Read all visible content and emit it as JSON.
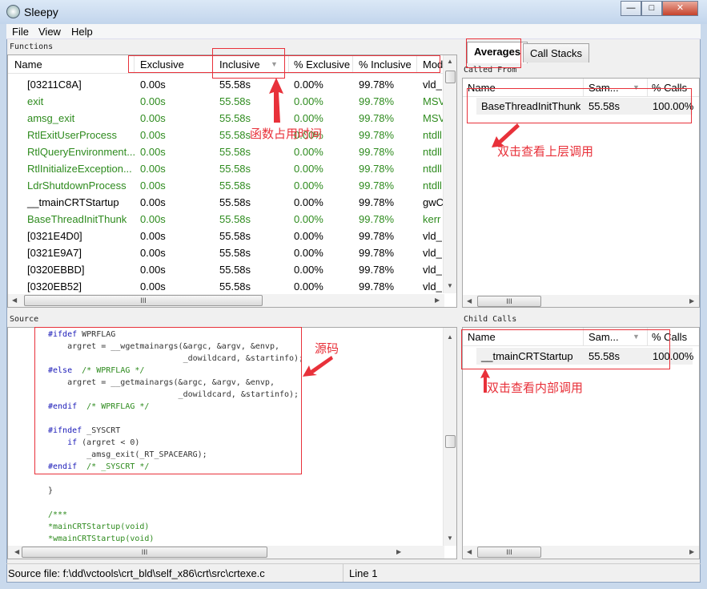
{
  "window": {
    "title": "Sleepy",
    "controls": [
      "minimize",
      "maximize",
      "close"
    ]
  },
  "menu": [
    "File",
    "View",
    "Help"
  ],
  "functions": {
    "label": "Functions",
    "columns": [
      "Name",
      "Exclusive",
      "Inclusive",
      "% Exclusive",
      "% Inclusive",
      "Mod"
    ],
    "sorted_by": "Inclusive",
    "rows": [
      {
        "name": "[03211C8A]",
        "exclusive": "0.00s",
        "inclusive": "55.58s",
        "pct_exclusive": "0.00%",
        "pct_inclusive": "99.78%",
        "module": "vld_:",
        "color": "black"
      },
      {
        "name": "exit",
        "exclusive": "0.00s",
        "inclusive": "55.58s",
        "pct_exclusive": "0.00%",
        "pct_inclusive": "99.78%",
        "module": "MSV",
        "color": "green"
      },
      {
        "name": "amsg_exit",
        "exclusive": "0.00s",
        "inclusive": "55.58s",
        "pct_exclusive": "0.00%",
        "pct_inclusive": "99.78%",
        "module": "MSV",
        "color": "green"
      },
      {
        "name": "RtlExitUserProcess",
        "exclusive": "0.00s",
        "inclusive": "55.58s",
        "pct_exclusive": "0.00%",
        "pct_inclusive": "99.78%",
        "module": "ntdll",
        "color": "green"
      },
      {
        "name": "RtlQueryEnvironment...",
        "exclusive": "0.00s",
        "inclusive": "55.58s",
        "pct_exclusive": "0.00%",
        "pct_inclusive": "99.78%",
        "module": "ntdll",
        "color": "green"
      },
      {
        "name": "RtlInitializeException...",
        "exclusive": "0.00s",
        "inclusive": "55.58s",
        "pct_exclusive": "0.00%",
        "pct_inclusive": "99.78%",
        "module": "ntdll",
        "color": "green"
      },
      {
        "name": "LdrShutdownProcess",
        "exclusive": "0.00s",
        "inclusive": "55.58s",
        "pct_exclusive": "0.00%",
        "pct_inclusive": "99.78%",
        "module": "ntdll",
        "color": "green"
      },
      {
        "name": "__tmainCRTStartup",
        "exclusive": "0.00s",
        "inclusive": "55.58s",
        "pct_exclusive": "0.00%",
        "pct_inclusive": "99.78%",
        "module": "gwC",
        "color": "black"
      },
      {
        "name": "BaseThreadInitThunk",
        "exclusive": "0.00s",
        "inclusive": "55.58s",
        "pct_exclusive": "0.00%",
        "pct_inclusive": "99.78%",
        "module": "kerr",
        "color": "green"
      },
      {
        "name": "[0321E4D0]",
        "exclusive": "0.00s",
        "inclusive": "55.58s",
        "pct_exclusive": "0.00%",
        "pct_inclusive": "99.78%",
        "module": "vld_:",
        "color": "black"
      },
      {
        "name": "[0321E9A7]",
        "exclusive": "0.00s",
        "inclusive": "55.58s",
        "pct_exclusive": "0.00%",
        "pct_inclusive": "99.78%",
        "module": "vld_:",
        "color": "black"
      },
      {
        "name": "[0320EBBD]",
        "exclusive": "0.00s",
        "inclusive": "55.58s",
        "pct_exclusive": "0.00%",
        "pct_inclusive": "99.78%",
        "module": "vld_:",
        "color": "black"
      },
      {
        "name": "[0320EB52]",
        "exclusive": "0.00s",
        "inclusive": "55.58s",
        "pct_exclusive": "0.00%",
        "pct_inclusive": "99.78%",
        "module": "vld_:",
        "color": "black"
      }
    ]
  },
  "source": {
    "label": "Source",
    "lines": [
      [
        {
          "t": "#ifdef",
          "c": "kw"
        },
        {
          "t": " WPRFLAG"
        }
      ],
      [
        {
          "t": "    argret = __wgetmainargs(&argc, &argv, &envp,"
        }
      ],
      [
        {
          "t": "                            _dowildcard, &startinfo);"
        }
      ],
      [
        {
          "t": "#else",
          "c": "kw"
        },
        {
          "t": "  /* WPRFLAG */",
          "c": "cm"
        }
      ],
      [
        {
          "t": "    argret = __getmainargs(&argc, &argv, &envp,"
        }
      ],
      [
        {
          "t": "                           _dowildcard, &startinfo);"
        }
      ],
      [
        {
          "t": "#endif",
          "c": "kw"
        },
        {
          "t": "  /* WPRFLAG */",
          "c": "cm"
        }
      ],
      [
        {
          "t": ""
        }
      ],
      [
        {
          "t": "#ifndef",
          "c": "kw"
        },
        {
          "t": " _SYSCRT"
        }
      ],
      [
        {
          "t": "    "
        },
        {
          "t": "if",
          "c": "kw"
        },
        {
          "t": " (argret < 0)"
        }
      ],
      [
        {
          "t": "        _amsg_exit(_RT_SPACEARG);"
        }
      ],
      [
        {
          "t": "#endif",
          "c": "kw"
        },
        {
          "t": "  /* _SYSCRT */",
          "c": "cm"
        }
      ],
      [
        {
          "t": ""
        }
      ],
      [
        {
          "t": "}"
        }
      ],
      [
        {
          "t": ""
        }
      ],
      [
        {
          "t": "/***",
          "c": "cm"
        }
      ],
      [
        {
          "t": "*mainCRTStartup(void)",
          "c": "cm"
        }
      ],
      [
        {
          "t": "*wmainCRTStartup(void)",
          "c": "cm"
        }
      ]
    ]
  },
  "tabs": [
    "Averages",
    "Call Stacks"
  ],
  "active_tab": "Averages",
  "called_from": {
    "label": "Called From",
    "columns": [
      "Name",
      "Sam...",
      "% Calls"
    ],
    "rows": [
      {
        "name": "BaseThreadInitThunk",
        "samples": "55.58s",
        "pct": "100.00%"
      }
    ]
  },
  "child_calls": {
    "label": "Child Calls",
    "columns": [
      "Name",
      "Sam...",
      "% Calls"
    ],
    "rows": [
      {
        "name": "__tmainCRTStartup",
        "samples": "55.58s",
        "pct": "100.00%"
      }
    ]
  },
  "status": {
    "file": "Source file: f:\\dd\\vctools\\crt_bld\\self_x86\\crt\\src\\crtexe.c",
    "line": "Line 1"
  },
  "annotations": {
    "inclusive_time": "函数占用时间",
    "source": "源码",
    "caller": "双击查看上层调用",
    "callee": "双击查看内部调用",
    "color": "#e8313a"
  }
}
